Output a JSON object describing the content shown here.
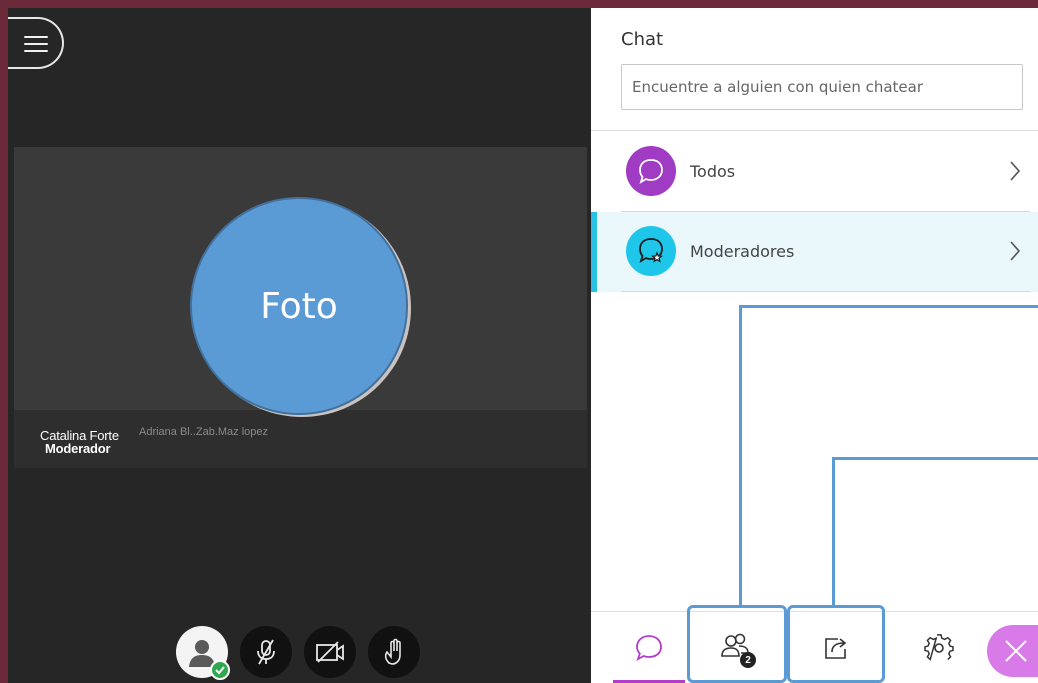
{
  "stage": {
    "menu_icon": "hamburger-menu-icon",
    "video": {
      "photo_label": "Foto",
      "participant_name": "Catalina Forte",
      "participant_role": "Moderador",
      "participant_ghost_text": "Adriana Bl..Zab.Maz lopez"
    },
    "controls": [
      {
        "name": "avatar-status-button",
        "icon": "user-avatar-icon"
      },
      {
        "name": "microphone-button",
        "icon": "microphone-muted-icon"
      },
      {
        "name": "camera-button",
        "icon": "camera-off-icon"
      },
      {
        "name": "raise-hand-button",
        "icon": "hand-icon"
      }
    ]
  },
  "panel": {
    "title": "Chat",
    "search_placeholder": "Encuentre a alguien con quien chatear",
    "channels": [
      {
        "label": "Todos",
        "icon": "chat-bubble-icon",
        "color": "#a03cc4"
      },
      {
        "label": "Moderadores",
        "icon": "moderator-chat-icon",
        "color": "#1ec6ea"
      }
    ],
    "tabs": {
      "chat_icon": "chat-bubble-icon",
      "participants_icon": "participants-icon",
      "participants_count": "2",
      "share_icon": "share-content-icon",
      "settings_icon": "gear-icon",
      "close_icon": "close-icon"
    }
  },
  "colors": {
    "accent_purple": "#b43ccc",
    "accent_cyan": "#29c2e6",
    "annotation_blue": "#5b9bd5",
    "frame": "#6b2a3a"
  }
}
